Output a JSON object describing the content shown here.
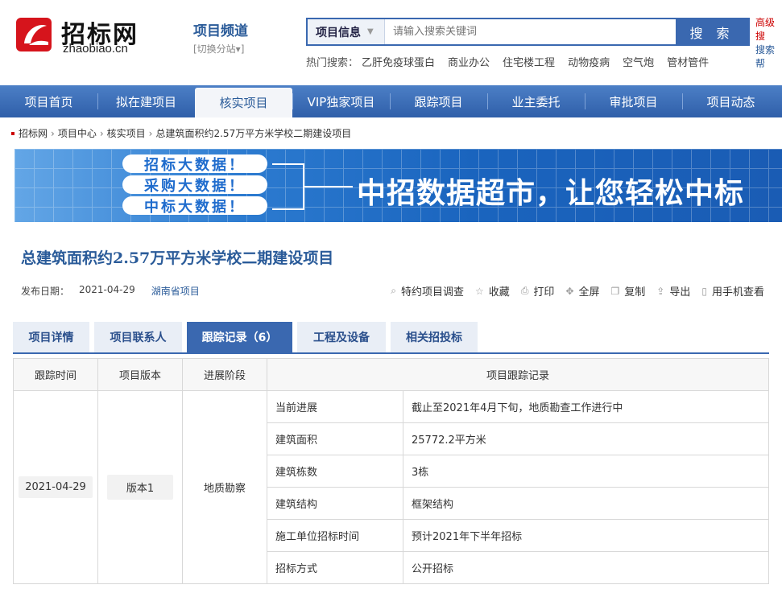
{
  "logo": {
    "cn": "招标网",
    "en": "zhaobiao.cn"
  },
  "channel": {
    "title": "项目频道",
    "switch": "[切换分站▾]"
  },
  "search": {
    "category": "项目信息",
    "placeholder": "请输入搜索关键词",
    "button": "搜 索",
    "advanced1": "高级搜",
    "advanced2": "搜索帮"
  },
  "hot": {
    "label": "热门搜索：",
    "items": [
      "乙肝免疫球蛋白",
      "商业办公",
      "住宅楼工程",
      "动物疫病",
      "空气炮",
      "管材管件"
    ]
  },
  "nav": [
    "项目首页",
    "拟在建项目",
    "核实项目",
    "VIP独家项目",
    "跟踪项目",
    "业主委托",
    "审批项目",
    "项目动态"
  ],
  "breadcrumb": [
    "招标网",
    "项目中心",
    "核实项目",
    "总建筑面积约2.57万平方米学校二期建设项目"
  ],
  "banner": {
    "tags": [
      "招标大数据！",
      "采购大数据！",
      "中标大数据！"
    ],
    "slogan": "中招数据超市，让您轻松中标"
  },
  "project": {
    "title": "总建筑面积约2.57万平方米学校二期建设项目",
    "date_label": "发布日期：",
    "date": "2021-04-29",
    "region": "湖南省项目"
  },
  "tools": [
    "特约项目调查",
    "收藏",
    "打印",
    "全屏",
    "复制",
    "导出",
    "用手机查看"
  ],
  "tabs": [
    "项目详情",
    "项目联系人",
    "跟踪记录（6）",
    "工程及设备",
    "相关招投标"
  ],
  "table": {
    "headers": [
      "跟踪时间",
      "项目版本",
      "进展阶段",
      "项目跟踪记录"
    ],
    "time": "2021-04-29",
    "version": "版本1",
    "stage": "地质勘察",
    "rows": [
      {
        "label": "当前进展",
        "value": "截止至2021年4月下旬，地质勘查工作进行中"
      },
      {
        "label": "建筑面积",
        "value": "25772.2平方米"
      },
      {
        "label": "建筑栋数",
        "value": "3栋"
      },
      {
        "label": "建筑结构",
        "value": "框架结构"
      },
      {
        "label": "施工单位招标时间",
        "value": "预计2021年下半年招标"
      },
      {
        "label": "招标方式",
        "value": "公开招标"
      }
    ]
  }
}
